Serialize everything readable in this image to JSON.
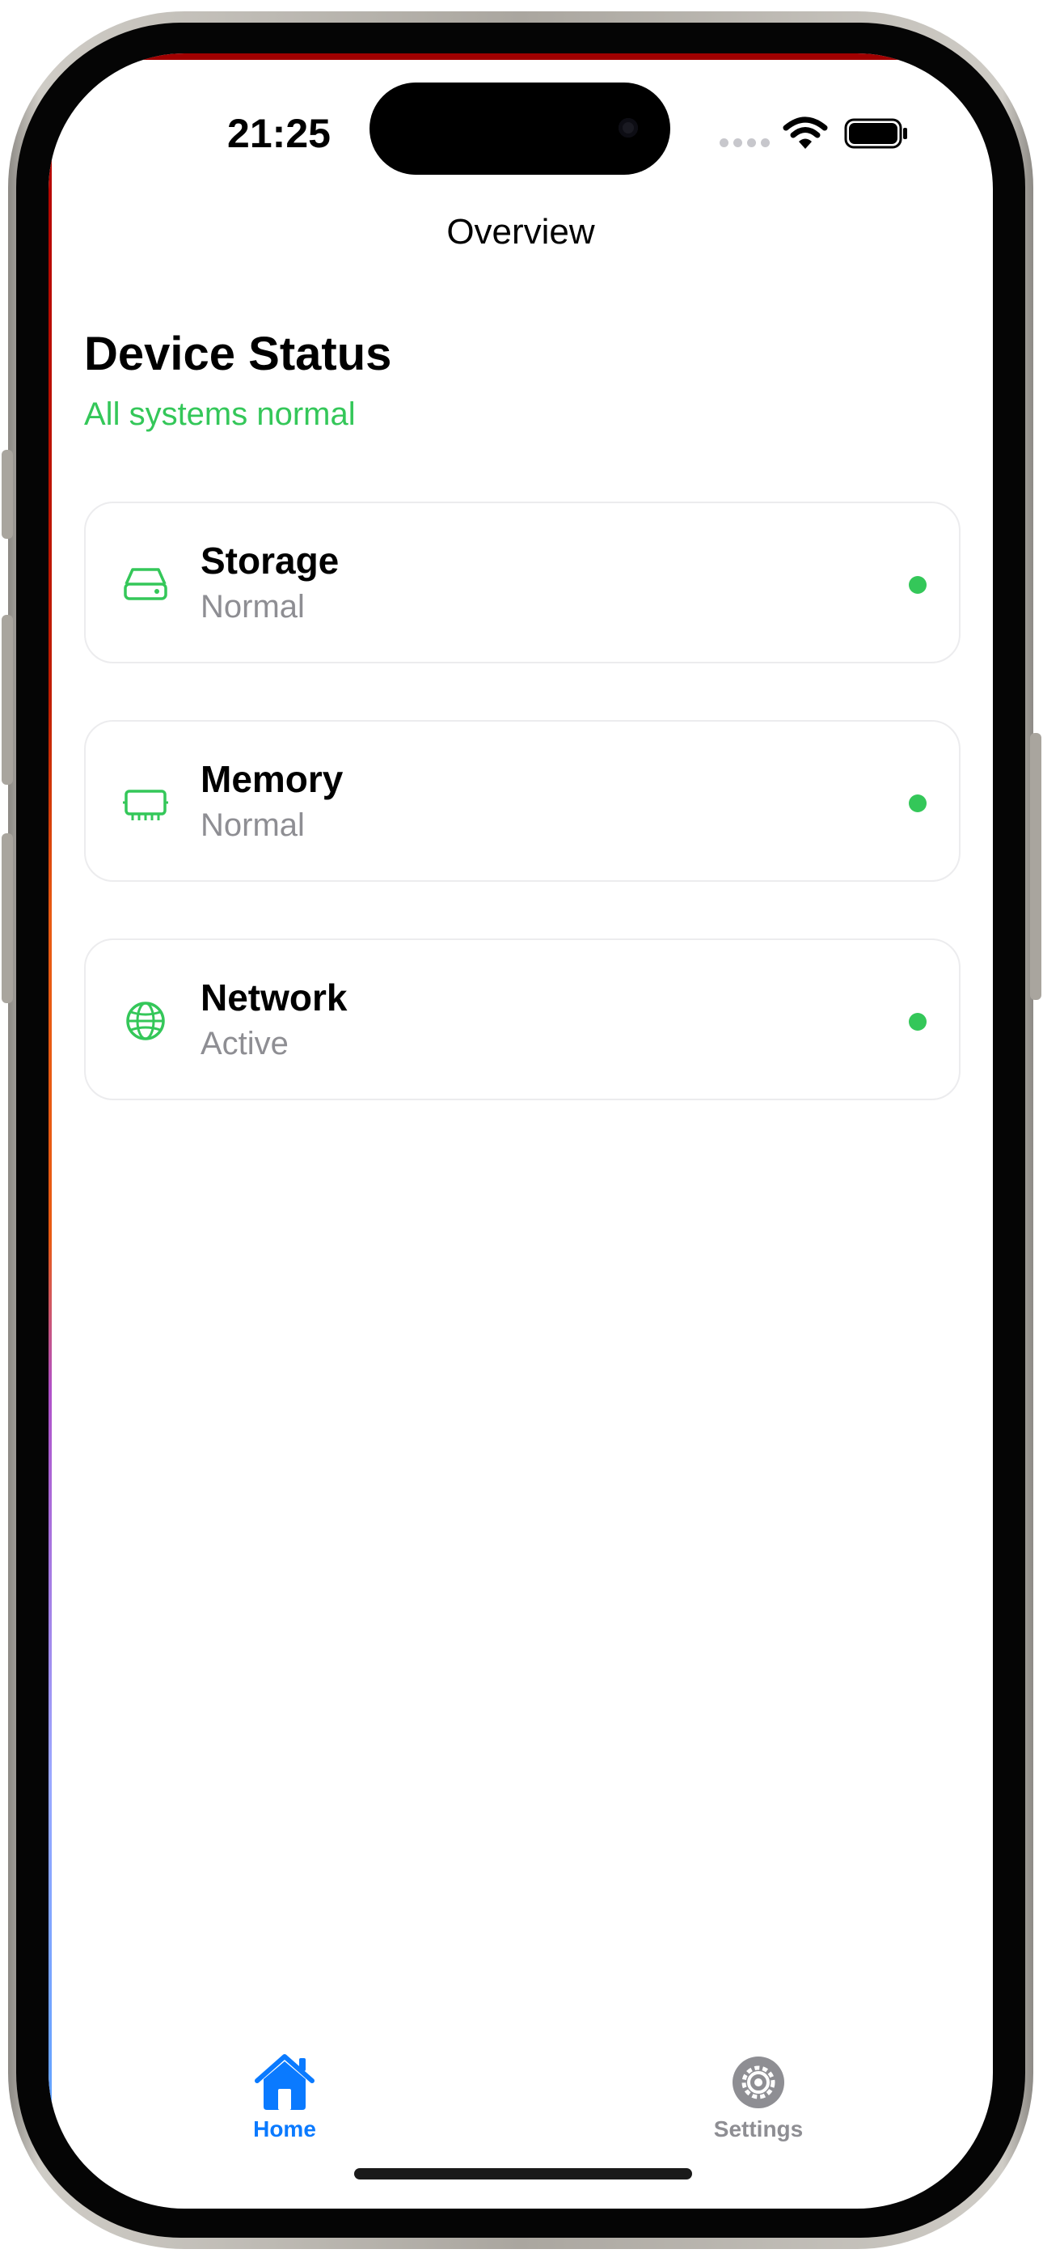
{
  "status_bar": {
    "time": "21:25",
    "icons": [
      "cellular-signal-icon",
      "wifi-icon",
      "battery-icon"
    ]
  },
  "nav": {
    "title": "Overview"
  },
  "header": {
    "title": "Device Status",
    "subtitle": "All systems normal"
  },
  "cards": [
    {
      "title": "Storage",
      "status": "Normal",
      "icon": "drive-icon",
      "indicator_color": "#34C759"
    },
    {
      "title": "Memory",
      "status": "Normal",
      "icon": "memory-chip-icon",
      "indicator_color": "#34C759"
    },
    {
      "title": "Network",
      "status": "Active",
      "icon": "globe-icon",
      "indicator_color": "#34C759"
    }
  ],
  "tab_bar": {
    "tabs": [
      {
        "label": "Home",
        "icon": "house-icon",
        "selected": true
      },
      {
        "label": "Settings",
        "icon": "gear-icon",
        "selected": false
      }
    ]
  },
  "colors": {
    "accent_green": "#34C759",
    "tab_selected": "#0A7AFF",
    "tab_unselected": "#8E8E93",
    "secondary_text": "#8E8E93"
  }
}
